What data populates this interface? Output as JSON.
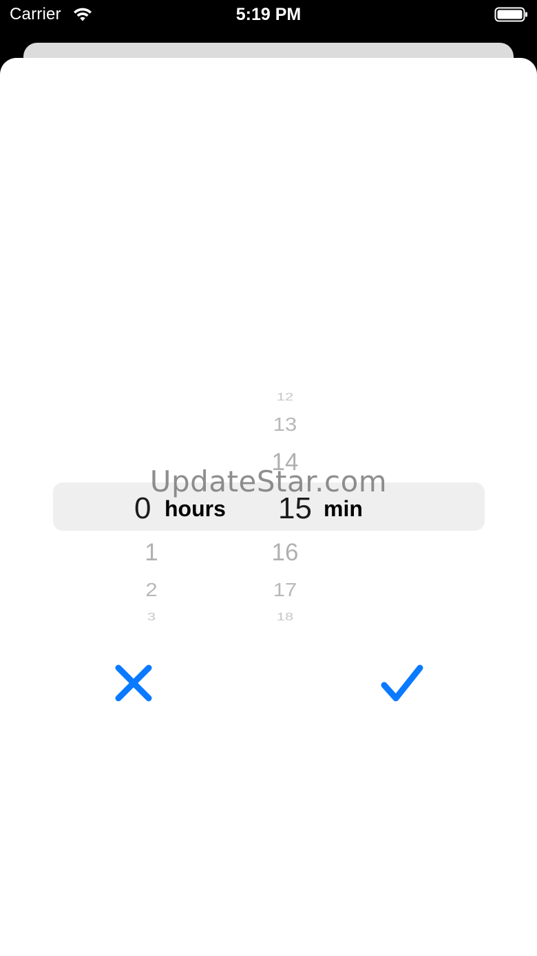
{
  "status_bar": {
    "carrier": "Carrier",
    "time": "5:19 PM",
    "wifi_icon": "wifi-icon",
    "battery_icon": "battery-full-icon"
  },
  "picker": {
    "hours": {
      "selected": "0",
      "unit": "hours",
      "below": [
        "1",
        "2",
        "3"
      ]
    },
    "minutes": {
      "selected": "15",
      "unit": "min",
      "above": [
        "12",
        "13",
        "14"
      ],
      "below": [
        "16",
        "17",
        "18"
      ]
    }
  },
  "watermark": "UpdateStar.com",
  "actions": {
    "cancel_icon": "close-icon",
    "confirm_icon": "checkmark-icon"
  },
  "colors": {
    "accent": "#0a7aff",
    "highlight": "#efefef",
    "sheet": "#ffffff"
  }
}
